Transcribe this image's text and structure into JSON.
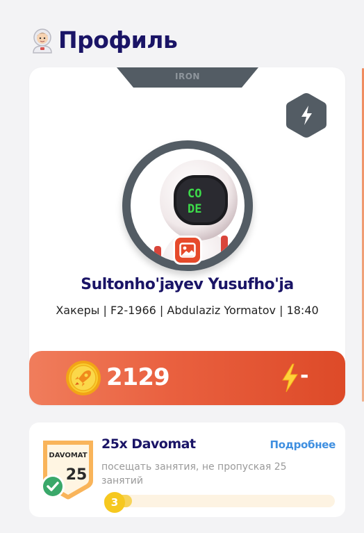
{
  "header": {
    "title": "Профиль",
    "icon": "astronaut-icon"
  },
  "profile": {
    "rank": "IRON",
    "rank_badge_icon": "lightning-hex-icon",
    "avatar": "robot-astronaut-code-avatar",
    "avatar_screen_text": "CO DE",
    "change_photo_icon": "image-icon",
    "name": "Sultonho'jayev Yusufho'ja",
    "info": "Хакеры | F2-1966 | Abdulaziz Yormatov | 18:40"
  },
  "stats": {
    "coins": "2129",
    "coin_icon": "rocket-coin-icon",
    "energy_icon": "lightning-icon",
    "energy": "-"
  },
  "achievement": {
    "badge_label": "DAVOMAT",
    "badge_number": "25",
    "title": "25x Davomat",
    "link": "Подробнее",
    "description": "посещать занятия, не пропуская 25 занятий",
    "progress_value": "3",
    "progress_current": 3,
    "progress_total": 25
  },
  "colors": {
    "title": "#1a1466",
    "accent_orange": "#e9603f",
    "link_blue": "#3f8fe0",
    "badge_gray": "#535c64",
    "coin_gold": "#f6c81f"
  }
}
